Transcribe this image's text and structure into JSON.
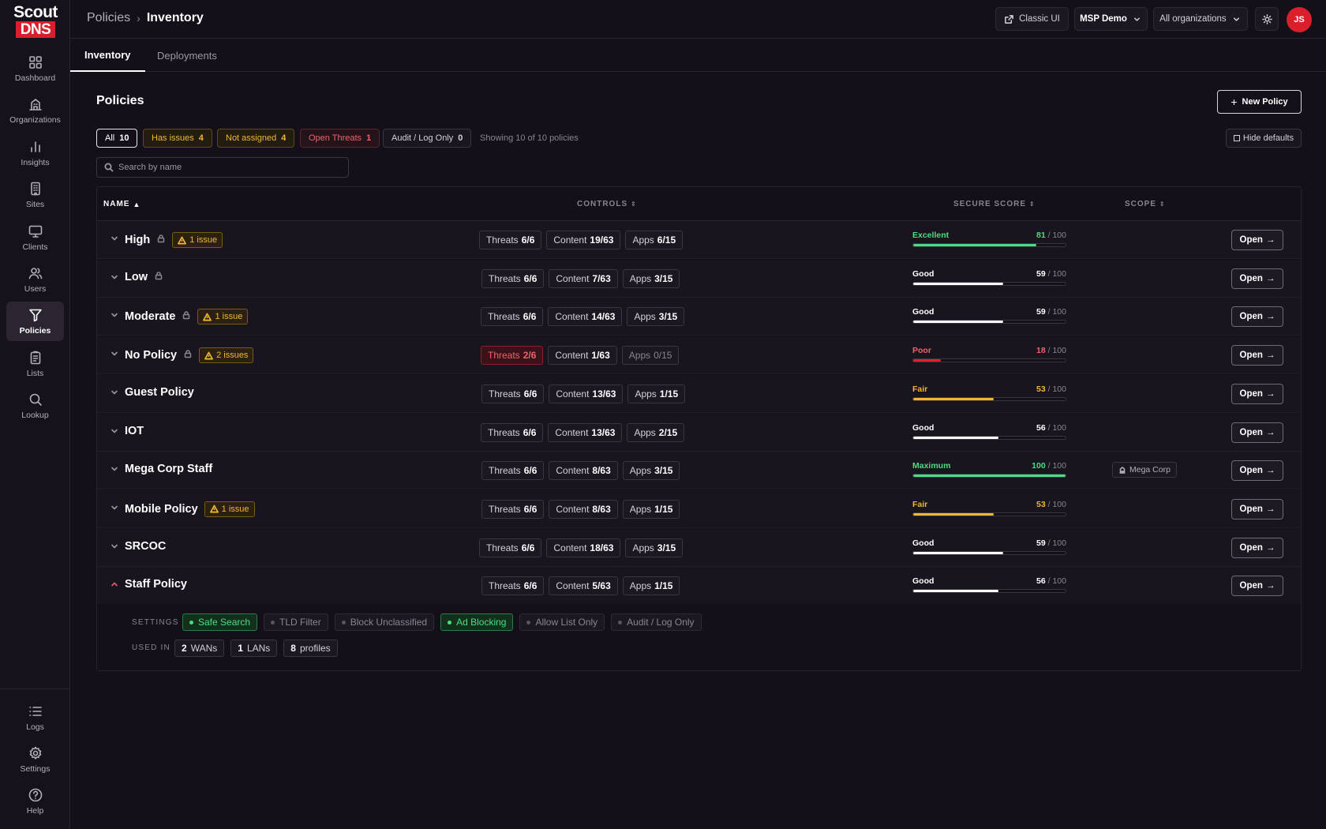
{
  "brand": {
    "line1": "Scout",
    "line2": "DNS"
  },
  "sidebar": {
    "items": [
      {
        "label": "Dashboard",
        "icon": "grid-icon"
      },
      {
        "label": "Organizations",
        "icon": "building-icon"
      },
      {
        "label": "Insights",
        "icon": "bar-chart-icon"
      },
      {
        "label": "Sites",
        "icon": "office-icon"
      },
      {
        "label": "Clients",
        "icon": "monitor-icon"
      },
      {
        "label": "Users",
        "icon": "users-icon"
      },
      {
        "label": "Policies",
        "icon": "filter-icon",
        "active": true
      },
      {
        "label": "Lists",
        "icon": "clipboard-icon"
      },
      {
        "label": "Lookup",
        "icon": "search-icon"
      }
    ],
    "bottom": [
      {
        "label": "Logs",
        "icon": "list-icon"
      },
      {
        "label": "Settings",
        "icon": "gear-icon"
      },
      {
        "label": "Help",
        "icon": "help-icon"
      }
    ]
  },
  "header": {
    "breadcrumb": {
      "parent": "Policies",
      "separator": "›",
      "current": "Inventory"
    },
    "classic_ui": "Classic UI",
    "tenant": "MSP Demo",
    "org_filter": "All organizations",
    "avatar_initials": "JS"
  },
  "tabs": [
    {
      "label": "Inventory",
      "active": true
    },
    {
      "label": "Deployments"
    }
  ],
  "page": {
    "title": "Policies",
    "new_policy": "New Policy",
    "filters": [
      {
        "label": "All",
        "count": "10",
        "style": "active"
      },
      {
        "label": "Has issues",
        "count": "4",
        "style": "amber"
      },
      {
        "label": "Not assigned",
        "count": "4",
        "style": "amber"
      },
      {
        "label": "Open Threats",
        "count": "1",
        "style": "red"
      },
      {
        "label": "Audit / Log Only",
        "count": "0",
        "style": "default"
      }
    ],
    "showing": "Showing 10 of 10 policies",
    "hide_defaults": "Hide defaults",
    "search_placeholder": "Search by name"
  },
  "table": {
    "columns": {
      "name": "NAME",
      "controls": "CONTROLS",
      "score": "SECURE SCORE",
      "scope": "SCOPE"
    },
    "open_label": "Open",
    "rows": [
      {
        "name": "High",
        "locked": true,
        "issue": "1 issue",
        "threats": "6/6",
        "content": "19/63",
        "apps": "6/15",
        "score_label": "Excellent",
        "score": 81,
        "max": "100",
        "tier": "green"
      },
      {
        "name": "Low",
        "locked": true,
        "issue": "",
        "threats": "6/6",
        "content": "7/63",
        "apps": "3/15",
        "score_label": "Good",
        "score": 59,
        "max": "100",
        "tier": "white"
      },
      {
        "name": "Moderate",
        "locked": true,
        "issue": "1 issue",
        "threats": "6/6",
        "content": "14/63",
        "apps": "3/15",
        "score_label": "Good",
        "score": 59,
        "max": "100",
        "tier": "white"
      },
      {
        "name": "No Policy",
        "locked": true,
        "issue": "2 issues",
        "threats": "2/6",
        "content": "1/63",
        "apps": "0/15",
        "score_label": "Poor",
        "score": 18,
        "max": "100",
        "tier": "red",
        "threats_bad": true,
        "apps_dim": true
      },
      {
        "name": "Guest Policy",
        "locked": false,
        "issue": "",
        "threats": "6/6",
        "content": "13/63",
        "apps": "1/15",
        "score_label": "Fair",
        "score": 53,
        "max": "100",
        "tier": "amber"
      },
      {
        "name": "IOT",
        "locked": false,
        "issue": "",
        "threats": "6/6",
        "content": "13/63",
        "apps": "2/15",
        "score_label": "Good",
        "score": 56,
        "max": "100",
        "tier": "white"
      },
      {
        "name": "Mega Corp Staff",
        "locked": false,
        "issue": "",
        "threats": "6/6",
        "content": "8/63",
        "apps": "3/15",
        "score_label": "Maximum",
        "score": 100,
        "max": "100",
        "tier": "green",
        "scope": "Mega Corp"
      },
      {
        "name": "Mobile Policy",
        "locked": false,
        "issue": "1 issue",
        "threats": "6/6",
        "content": "8/63",
        "apps": "1/15",
        "score_label": "Fair",
        "score": 53,
        "max": "100",
        "tier": "amber"
      },
      {
        "name": "SRCOC",
        "locked": false,
        "issue": "",
        "threats": "6/6",
        "content": "18/63",
        "apps": "3/15",
        "score_label": "Good",
        "score": 59,
        "max": "100",
        "tier": "white"
      },
      {
        "name": "Staff Policy",
        "locked": false,
        "issue": "",
        "threats": "6/6",
        "content": "5/63",
        "apps": "1/15",
        "score_label": "Good",
        "score": 56,
        "max": "100",
        "tier": "white",
        "expanded": true
      }
    ],
    "control_labels": {
      "threats": "Threats",
      "content": "Content",
      "apps": "Apps"
    }
  },
  "expanded": {
    "settings_label": "SETTINGS",
    "settings": [
      {
        "label": "Safe Search",
        "on": true
      },
      {
        "label": "TLD Filter",
        "on": false
      },
      {
        "label": "Block Unclassified",
        "on": false
      },
      {
        "label": "Ad Blocking",
        "on": true
      },
      {
        "label": "Allow List Only",
        "on": false
      },
      {
        "label": "Audit / Log Only",
        "on": false
      }
    ],
    "used_label": "USED IN",
    "used": [
      {
        "count": "2",
        "label": "WANs"
      },
      {
        "count": "1",
        "label": "LANs"
      },
      {
        "count": "8",
        "label": "profiles"
      }
    ]
  },
  "colors": {
    "green": "#4ade80",
    "white": "#ffffff",
    "amber": "#f2b632",
    "red": "#e11d2e",
    "accent": "#d91f2b"
  }
}
